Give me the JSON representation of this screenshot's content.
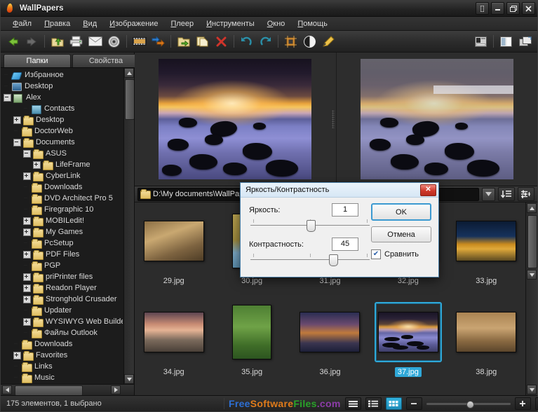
{
  "window": {
    "title": "WallPapers",
    "buttons": {
      "help": "?",
      "minimize": "–",
      "maximize": "❐",
      "close": "✕"
    }
  },
  "menu": [
    "Файл",
    "Правка",
    "Вид",
    "Изображение",
    "Плеер",
    "Инструменты",
    "Окно",
    "Помощь"
  ],
  "toolbar": {
    "left": [
      {
        "name": "back-icon",
        "title": "Назад"
      },
      {
        "name": "forward-icon",
        "title": "Вперёд"
      },
      {
        "name": "up-folder-icon",
        "title": "Вверх"
      },
      {
        "name": "print-icon",
        "title": "Печать"
      },
      {
        "name": "mail-icon",
        "title": "Отправить"
      },
      {
        "name": "disc-icon",
        "title": "Записать"
      },
      {
        "name": "filmstrip-icon",
        "title": "Слайдшоу"
      },
      {
        "name": "convert-icon",
        "title": "Конвертировать"
      },
      {
        "name": "move-folder-icon",
        "title": "Переместить"
      },
      {
        "name": "copy-icon",
        "title": "Копировать"
      },
      {
        "name": "delete-icon",
        "title": "Удалить"
      },
      {
        "name": "undo-icon",
        "title": "Отменить"
      },
      {
        "name": "redo-icon",
        "title": "Вернуть"
      },
      {
        "name": "crop-icon",
        "title": "Обрезать"
      },
      {
        "name": "contrast-icon",
        "title": "Яркость/Контрастность"
      },
      {
        "name": "pencil-icon",
        "title": "Редактировать"
      }
    ],
    "right": [
      {
        "name": "preview-pane-icon",
        "title": "Просмотр"
      },
      {
        "name": "split-pane-icon",
        "title": "Панели"
      },
      {
        "name": "layout-icon",
        "title": "Вид окна"
      }
    ]
  },
  "sidebar": {
    "tabs": [
      {
        "label": "Папки",
        "active": true
      },
      {
        "label": "Свойства",
        "active": false
      }
    ],
    "tree": [
      {
        "label": "Избранное",
        "indent": 0,
        "expander": "none",
        "icon": "favorites-icon"
      },
      {
        "label": "Desktop",
        "indent": 0,
        "expander": "none",
        "icon": "desktop-icon"
      },
      {
        "label": "Alex",
        "indent": 0,
        "expander": "minus",
        "icon": "user-folder-icon"
      },
      {
        "label": "Contacts",
        "indent": 2,
        "expander": "none",
        "icon": "contacts-icon"
      },
      {
        "label": "Desktop",
        "indent": 1,
        "expander": "plus",
        "icon": "folder-icon"
      },
      {
        "label": "DoctorWeb",
        "indent": 1,
        "expander": "none",
        "icon": "folder-icon"
      },
      {
        "label": "Documents",
        "indent": 1,
        "expander": "minus",
        "icon": "folder-icon"
      },
      {
        "label": "ASUS",
        "indent": 2,
        "expander": "minus",
        "icon": "folder-icon"
      },
      {
        "label": "LifeFrame",
        "indent": 3,
        "expander": "plus",
        "icon": "folder-icon"
      },
      {
        "label": "CyberLink",
        "indent": 2,
        "expander": "plus",
        "icon": "folder-icon"
      },
      {
        "label": "Downloads",
        "indent": 2,
        "expander": "none",
        "icon": "folder-icon"
      },
      {
        "label": "DVD Architect Pro 5",
        "indent": 2,
        "expander": "none",
        "icon": "folder-icon"
      },
      {
        "label": "Firegraphic 10",
        "indent": 2,
        "expander": "none",
        "icon": "folder-icon"
      },
      {
        "label": "MOBILedit!",
        "indent": 2,
        "expander": "plus",
        "icon": "folder-icon"
      },
      {
        "label": "My Games",
        "indent": 2,
        "expander": "plus",
        "icon": "folder-icon"
      },
      {
        "label": "PcSetup",
        "indent": 2,
        "expander": "none",
        "icon": "folder-icon"
      },
      {
        "label": "PDF Files",
        "indent": 2,
        "expander": "plus",
        "icon": "folder-icon"
      },
      {
        "label": "PGP",
        "indent": 2,
        "expander": "none",
        "icon": "folder-icon"
      },
      {
        "label": "priPrinter files",
        "indent": 2,
        "expander": "plus",
        "icon": "folder-icon"
      },
      {
        "label": "Readon Player",
        "indent": 2,
        "expander": "plus",
        "icon": "folder-icon"
      },
      {
        "label": "Stronghold Crusader",
        "indent": 2,
        "expander": "plus",
        "icon": "folder-icon"
      },
      {
        "label": "Updater",
        "indent": 2,
        "expander": "none",
        "icon": "folder-icon"
      },
      {
        "label": "WYSIWYG Web Builder",
        "indent": 2,
        "expander": "plus",
        "icon": "folder-icon"
      },
      {
        "label": "Файлы Outlook",
        "indent": 2,
        "expander": "none",
        "icon": "folder-icon"
      },
      {
        "label": "Downloads",
        "indent": 1,
        "expander": "none",
        "icon": "folder-icon"
      },
      {
        "label": "Favorites",
        "indent": 1,
        "expander": "plus",
        "icon": "folder-icon"
      },
      {
        "label": "Links",
        "indent": 1,
        "expander": "none",
        "icon": "folder-icon"
      },
      {
        "label": "Music",
        "indent": 1,
        "expander": "none",
        "icon": "folder-icon"
      }
    ]
  },
  "pathbar": {
    "path": "D:\\My documents\\WallPapers",
    "dropdown_icon": "chevron-down-icon",
    "sort_button": "sort-icon",
    "filter_button": "filter-icon"
  },
  "thumbnails": [
    {
      "label": "29.jpg",
      "art": "a-birds",
      "selected": false
    },
    {
      "label": "30.jpg",
      "art": "a-leopard",
      "selected": false,
      "portrait": true
    },
    {
      "label": "31.jpg",
      "art": "a-sea",
      "selected": false
    },
    {
      "label": "32.jpg",
      "art": "a-sunset34",
      "selected": false
    },
    {
      "label": "33.jpg",
      "art": "a-city33",
      "selected": false
    },
    {
      "label": "34.jpg",
      "art": "a-sunset34",
      "selected": false
    },
    {
      "label": "35.jpg",
      "art": "a-deer",
      "selected": false,
      "portrait": true
    },
    {
      "label": "36.jpg",
      "art": "a-bridge36",
      "selected": false
    },
    {
      "label": "37.jpg",
      "art": "a-sea",
      "selected": true
    },
    {
      "label": "38.jpg",
      "art": "a-squirrel",
      "selected": false
    }
  ],
  "dialog": {
    "title": "Яркость/Контрастность",
    "close_label": "✕",
    "brightness_label": "Яркость:",
    "brightness_value": "1",
    "contrast_label": "Контрастность:",
    "contrast_value": "45",
    "ok_label": "OK",
    "cancel_label": "Отмена",
    "compare_label": "Сравнить",
    "compare_checked": true,
    "check_glyph": "✔"
  },
  "statusbar": {
    "text": "175 элементов, 1 выбрано",
    "watermark": {
      "part1": "Free",
      "part2": "Software",
      "part3": "Files",
      "part4": ".com"
    },
    "view_buttons": [
      {
        "name": "list-view-button",
        "active": false
      },
      {
        "name": "details-view-button",
        "active": false
      },
      {
        "name": "thumbnail-view-button",
        "active": true
      }
    ],
    "zoom_minus": "–",
    "zoom_plus": "+",
    "fullscreen_button": "fullscreen-icon"
  },
  "colors": {
    "accent": "#2fa8d8",
    "window_bg": "#2b2b2b",
    "panel_bg": "#1c1c1c",
    "dialog_bg": "#f0f0f0"
  }
}
